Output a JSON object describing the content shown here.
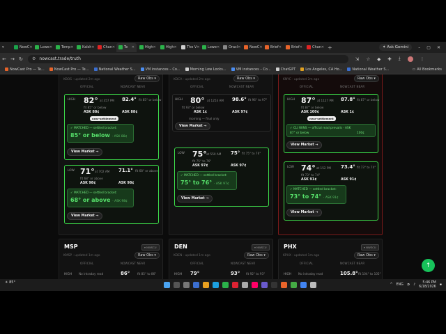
{
  "tabs": [
    {
      "label": "NowC",
      "color": "#1aa34a"
    },
    {
      "label": "Lowe",
      "color": "#2bb24a"
    },
    {
      "label": "Temp",
      "color": "#2bb24a"
    },
    {
      "label": "Kalsh",
      "color": "#2bb24a"
    },
    {
      "label": "Chan",
      "color": "#e02424"
    },
    {
      "label": "Te",
      "color": "#2bb24a",
      "active": true
    },
    {
      "label": "High",
      "color": "#2bb24a"
    },
    {
      "label": "High",
      "color": "#2bb24a"
    },
    {
      "label": "The V",
      "color": "#cfcfcf"
    },
    {
      "label": "Lowe",
      "color": "#2bb24a"
    },
    {
      "label": "Oracl",
      "color": "#888888"
    },
    {
      "label": "NowC",
      "color": "#e8642a"
    },
    {
      "label": "Brief",
      "color": "#e8642a"
    },
    {
      "label": "Brief",
      "color": "#e8642a"
    },
    {
      "label": "Chan",
      "color": "#e02424"
    }
  ],
  "toolbar": {
    "gemini_label": "Ask Gemini",
    "url": "nowcast.trade/truth"
  },
  "bookmarks": [
    {
      "label": "NowCast Pro — Te...",
      "color": "#e8642a"
    },
    {
      "label": "NowCast Pro — Te...",
      "color": "#e8642a"
    },
    {
      "label": "National Weather S...",
      "color": "#3b6fd1"
    },
    {
      "label": "VM instances – Co...",
      "color": "#4b8df0"
    },
    {
      "label": "Morning Low Locks...",
      "color": "#cfcfcf"
    },
    {
      "label": "VM instances – Co...",
      "color": "#4b8df0"
    },
    {
      "label": "ChatGPT",
      "color": "#cfcfcf"
    },
    {
      "label": "Los Angeles, CA Ho...",
      "color": "#e0a020"
    },
    {
      "label": "National Weather S...",
      "color": "#3b6fd1"
    }
  ],
  "all_bookmarks": "All Bookmarks",
  "cards_top": [
    {
      "header": "KBOS · updated 2m ago",
      "raw": "Raw Obs ▾",
      "col_official": "OFFICIAL",
      "col_nowcast": "NOWCAST NEAR",
      "high": {
        "label": "HIGH",
        "temp": "82°",
        "at": "at 357 PM",
        "nc": "82.4°",
        "fit": "fit 85° or below",
        "fit2": "fit 85° or below",
        "ask": "ASK 88¢",
        "chip": "near-settlement"
      },
      "high_match": {
        "title": "✓ MATCHED — settled bracket:",
        "value": "85° or below",
        "ask": "· ASK 88¢"
      },
      "low": {
        "label": "LOW",
        "temp": "71°",
        "at": "at 702 AM",
        "nc": "71.1°",
        "fit": "fit 68° or above",
        "fit2": "fit 68° or above",
        "ask": "ASK 98¢"
      },
      "low_match": {
        "title": "✓ MATCHED — settled bracket:",
        "value": "68° or above",
        "ask": "· ASK 98¢"
      },
      "view": "View Market →"
    },
    {
      "header": "KDCA · updated 2m ago",
      "raw": "Raw Obs ▾",
      "col_official": "OFFICIAL",
      "col_nowcast": "NOWCAST NEAR",
      "high": {
        "label": "HIGH",
        "temp": "80°",
        "at": "at 1253 AM",
        "nc": "98.6°",
        "fit": "fit 93° or below",
        "fit2": "fit 96° to 97°",
        "ask": "ASK 1¢",
        "ask2": "ASK 97¢",
        "note": "morning — final only"
      },
      "low": {
        "label": "LOW",
        "temp": "75°",
        "at": "at 550 AM",
        "nc": "75°",
        "fit": "fit 75° to 76°",
        "fit2": "fit 75° to 76°",
        "ask": "ASK 97¢",
        "ask2": "ASK 97¢"
      },
      "low_match": {
        "title": "✓ MATCHED — settled bracket:",
        "value": "75° to 76°",
        "ask": "· ASK 97¢"
      },
      "view": "View Market →"
    },
    {
      "header": "KNYC · updated 2m ago",
      "raw": "Raw Obs ▾",
      "col_official": "OFFICIAL",
      "col_nowcast": "NOWCAST NEAR",
      "high": {
        "label": "HIGH",
        "temp": "87°",
        "at": "at 1127 PM",
        "nc": "87.8°",
        "fit": "fit 87° or below",
        "fit2": "fit 87° or below",
        "ask": "ASK 100¢",
        "ask2": "ASK 1¢",
        "chip": "near-settlement"
      },
      "high_match": {
        "title": "✓ CLI WINS — official read prevails · ASK",
        "value": "",
        "sub": "87° or below",
        "ask": "100¢"
      },
      "low": {
        "label": "LOW",
        "temp": "74°",
        "at": "at 152 PM",
        "nc": "73.4°",
        "fit": "fit 73° to 74°",
        "fit2": "fit 73° to 74°",
        "ask": "ASK 91¢",
        "ask2": "ASK 91¢"
      },
      "low_match": {
        "title": "✓ MATCHED — settled bracket:",
        "value": "73° to 74°",
        "ask": "· ASK 91¢"
      },
      "view": "View Market →"
    }
  ],
  "cards_bottom": [
    {
      "city": "MSP",
      "badge": "▾ NWSCU",
      "header": "KMSP · updated 1m ago",
      "raw": "Raw Obs ▾",
      "col_official": "OFFICIAL",
      "col_nowcast": "NOWCAST NEAR",
      "row_label": "HIGH",
      "row_note": "No intraday read",
      "row_temp": "86°",
      "row_fit": "fit 85° to 86°"
    },
    {
      "city": "DEN",
      "badge": "▾ NWSCU",
      "header": "KDEN · updated 1m ago",
      "raw": "Raw Obs ▾",
      "col_official": "OFFICIAL",
      "col_nowcast": "NOWCAST NEAR",
      "row_label": "HIGH",
      "row_note": "79°",
      "row_temp": "93°",
      "row_fit": "fit 92° to 93°"
    },
    {
      "city": "PHX",
      "badge": "▾ NWSCU",
      "header": "KPHX · updated 1m ago",
      "raw": "Raw Obs ▾",
      "col_official": "OFFICIAL",
      "col_nowcast": "NOWCAST NEAR",
      "row_label": "HIGH",
      "row_note": "No intraday read",
      "row_temp": "105.8°",
      "row_fit": "fit 104° to 105°"
    }
  ],
  "taskbar": {
    "weather": "85°",
    "lang": "ENG",
    "time": "5:46 PM",
    "date": "6/18/2026"
  }
}
